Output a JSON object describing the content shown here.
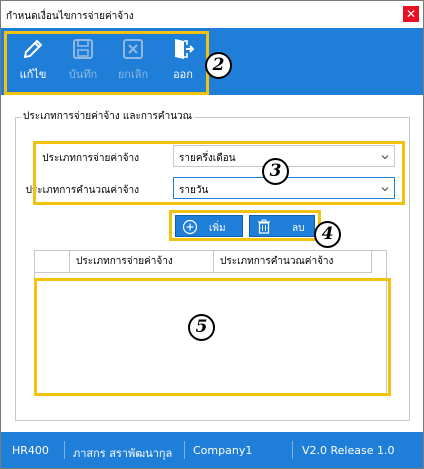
{
  "window": {
    "title": "กำหนดเงื่อนไขการจ่ายค่าจ้าง",
    "close_glyph": "✕"
  },
  "toolbar": {
    "edit_label": "แก้ไข",
    "save_label": "บันทึก",
    "cancel_label": "ยกเลิก",
    "exit_label": "ออก"
  },
  "group": {
    "title": "ประเภทการจ่ายค่าจ้าง และการคำนวณ",
    "pay_type_label": "ประเภทการจ่ายค่าจ้าง",
    "pay_type_value": "รายครึ่งเดือน",
    "calc_type_label": "ประเภทการคำนวณค่าจ้าง",
    "calc_type_value": "รายวัน",
    "add_label": "เพิ่ม",
    "delete_label": "ลบ"
  },
  "grid": {
    "columns": [
      "ประเภทการจ่ายค่าจ้าง",
      "ประเภทการคำนวณค่าจ้าง"
    ],
    "rows": []
  },
  "annotations": [
    "2",
    "3",
    "4",
    "5"
  ],
  "status": {
    "app": "HR400",
    "user": "ภาสกร สราพัฒนากุล",
    "company": "Company1",
    "version": "V2.0 Release 1.0"
  },
  "colors": {
    "accent": "#1e7ed8",
    "highlight": "#f3c20f",
    "close": "#e81123"
  }
}
